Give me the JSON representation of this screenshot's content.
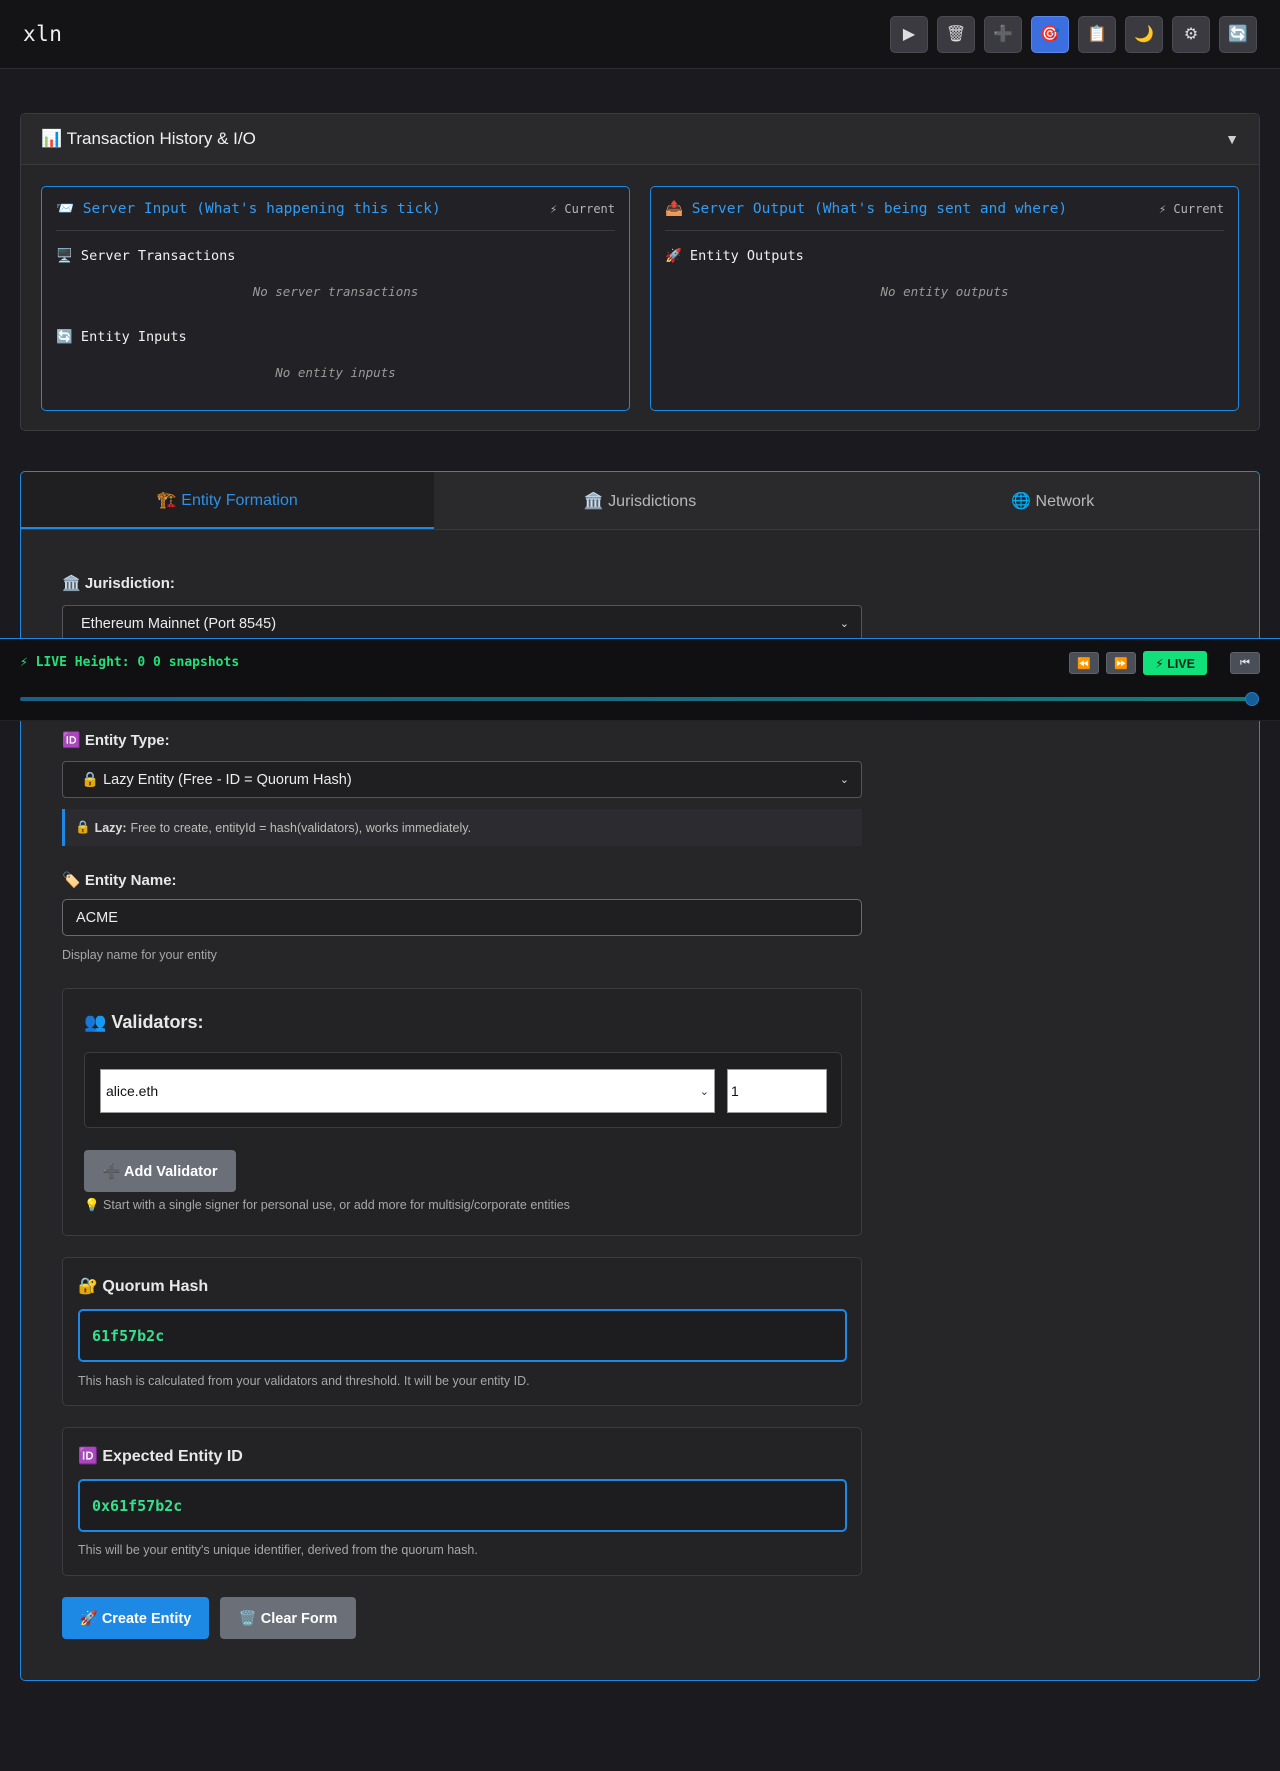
{
  "app": {
    "brand": "xln"
  },
  "toolbar": {
    "buttons": [
      {
        "icon": "play-icon",
        "glyph": "▶"
      },
      {
        "icon": "trash-icon",
        "glyph": "🗑"
      },
      {
        "icon": "plus-icon",
        "glyph": "➕"
      },
      {
        "icon": "target-icon",
        "glyph": "🎯"
      },
      {
        "icon": "clipboard-icon",
        "glyph": "📋"
      },
      {
        "icon": "moon-icon",
        "glyph": "🌙"
      },
      {
        "icon": "gear-icon",
        "glyph": "⚙"
      },
      {
        "icon": "refresh-icon",
        "glyph": "🔄"
      }
    ]
  },
  "history": {
    "title": "📊 Transaction History & I/O",
    "toggle": "▼",
    "input": {
      "title": "📨 Server Input (What's happening this tick)",
      "badge": "⚡ Current",
      "server_tx_label": "🖥️ Server Transactions",
      "server_tx_empty": "No server transactions",
      "entity_inputs_label": "🔄 Entity Inputs",
      "entity_inputs_empty": "No entity inputs"
    },
    "output": {
      "title": "📤 Server Output (What's being sent and where)",
      "badge": "⚡ Current",
      "entity_outputs_label": "🚀 Entity Outputs",
      "entity_outputs_empty": "No entity outputs"
    }
  },
  "tabs": [
    {
      "label": "🏗️ Entity Formation",
      "active": true
    },
    {
      "label": "🏛️ Jurisdictions",
      "active": false
    },
    {
      "label": "🌐 Network",
      "active": false
    }
  ],
  "form": {
    "jurisdiction_label": "🏛️ Jurisdiction:",
    "jurisdiction_value": "Ethereum Mainnet (Port 8545)",
    "entity_type_label": "🆔 Entity Type:",
    "entity_type_value": "🔒 Lazy Entity (Free - ID = Quorum Hash)",
    "lazy_note_prefix": "🔒",
    "lazy_note_bold": "Lazy:",
    "lazy_note_text": "Free to create, entityId = hash(validators), works immediately.",
    "entity_name_label": "🏷️ Entity Name:",
    "entity_name_value": "ACME",
    "entity_name_help": "Display name for your entity",
    "validators_title": "👥 Validators:",
    "validator_name": "alice.eth",
    "validator_weight": "1",
    "add_validator": "➕ Add Validator",
    "validators_tip": "💡 Start with a single signer for personal use, or add more for multisig/corporate entities",
    "quorum_title": "🔐 Quorum Hash",
    "quorum_value": "61f57b2c",
    "quorum_help": "This hash is calculated from your validators and threshold. It will be your entity ID.",
    "expected_title": "🆔 Expected Entity ID",
    "expected_value": "0x61f57b2c",
    "expected_help": "This will be your entity's unique identifier, derived from the quorum hash.",
    "create_button": "🚀 Create Entity",
    "clear_button": "🗑️ Clear Form"
  },
  "timemachine": {
    "status": "⚡ LIVE Height: 0 0 snapshots",
    "rewind_icon": "⏪",
    "forward_icon": "⏩",
    "live_label": "⚡ LIVE",
    "skip_icon": "⏮",
    "position": 1.0
  },
  "colors": {
    "accent": "#1e88e5",
    "live_green": "#12e07a",
    "hash_green": "#35e08a"
  }
}
